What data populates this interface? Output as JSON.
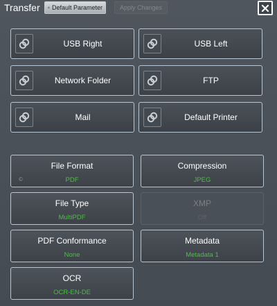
{
  "header": {
    "title": "Transfer",
    "default_parameter_label": "Default Parameter",
    "apply_changes_label": "Apply Changes"
  },
  "destinations": [
    {
      "label": "USB Right"
    },
    {
      "label": "USB Left"
    },
    {
      "label": "Network Folder"
    },
    {
      "label": "FTP"
    },
    {
      "label": "Mail"
    },
    {
      "label": "Default Printer"
    }
  ],
  "settings": {
    "file_format": {
      "label": "File Format",
      "value": "PDF",
      "mark": "©"
    },
    "compression": {
      "label": "Compression",
      "value": "JPEG"
    },
    "file_type": {
      "label": "File Type",
      "value": "MultiPDF"
    },
    "xmp": {
      "label": "XMP",
      "value": "Off"
    },
    "pdf_conformance": {
      "label": "PDF Conformance",
      "value": "None"
    },
    "metadata": {
      "label": "Metadata",
      "value": "Metadata 1"
    },
    "ocr": {
      "label": "OCR",
      "value": "OCR-EN-DE"
    }
  },
  "colors": {
    "value_green": "#46c23a",
    "tile_border": "#b8c6d4",
    "background": "#4a5058"
  },
  "icons": {
    "destination_icon": "link-icon",
    "close": "close-icon",
    "refresh": "refresh-icon"
  }
}
